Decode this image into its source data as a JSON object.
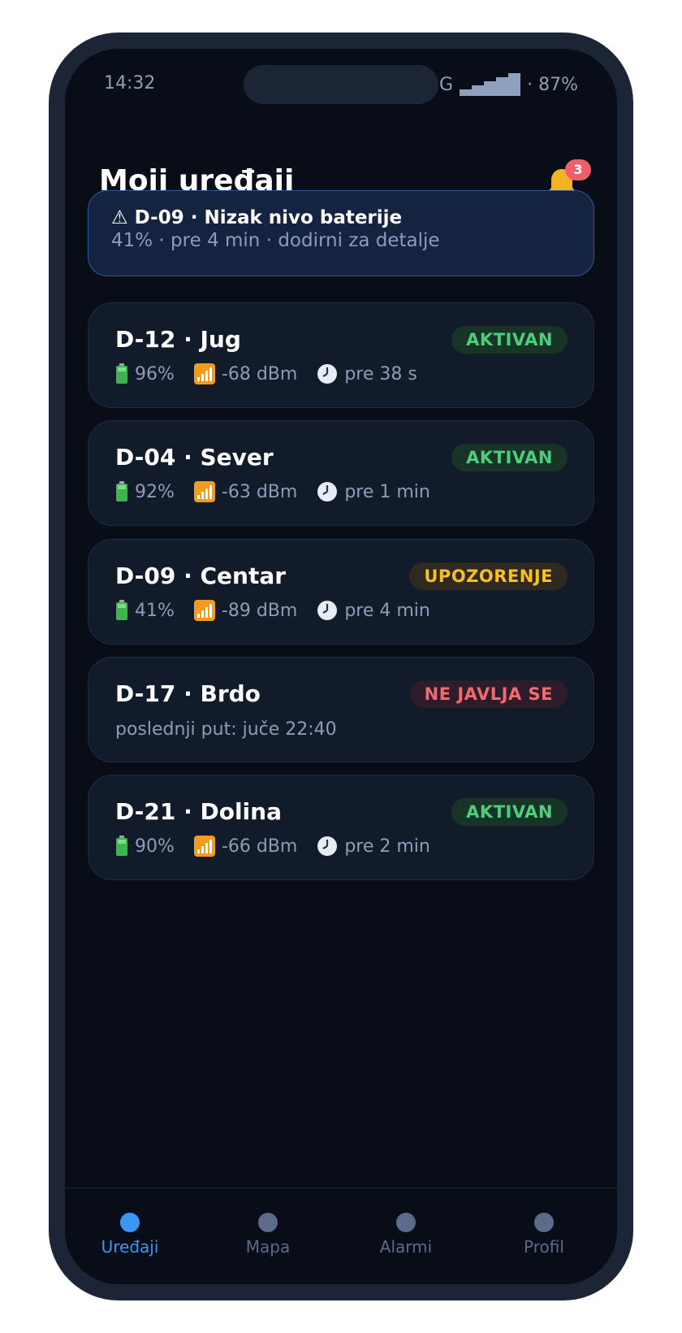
{
  "status_bar": {
    "time": "14:32",
    "network": "G",
    "battery": "· 87%"
  },
  "header": {
    "title": "Moji uređaji",
    "notification_count": "3"
  },
  "alert": {
    "title": "⚠ D-09 · Nizak nivo baterije",
    "subtitle": "41% · pre 4 min · dodirni za detalje"
  },
  "devices": [
    {
      "name": "D-12 · Jug",
      "status": "AKTIVAN",
      "status_kind": "ok",
      "battery": "96%",
      "signal": "-68 dBm",
      "last_seen": "pre 38 s"
    },
    {
      "name": "D-04 · Sever",
      "status": "AKTIVAN",
      "status_kind": "ok",
      "battery": "92%",
      "signal": "-63 dBm",
      "last_seen": "pre 1 min"
    },
    {
      "name": "D-09 · Centar",
      "status": "UPOZORENJE",
      "status_kind": "warn",
      "battery": "41%",
      "signal": "-89 dBm",
      "last_seen": "pre 4 min"
    },
    {
      "name": "D-17 · Brdo",
      "status": "NE JAVLJA SE",
      "status_kind": "off",
      "note": "poslednji put: juče 22:40"
    },
    {
      "name": "D-21 · Dolina",
      "status": "AKTIVAN",
      "status_kind": "ok",
      "battery": "90%",
      "signal": "-66 dBm",
      "last_seen": "pre 2 min"
    }
  ],
  "nav": {
    "items": [
      {
        "label": "Uređaji",
        "active": true
      },
      {
        "label": "Mapa",
        "active": false
      },
      {
        "label": "Alarmi",
        "active": false
      },
      {
        "label": "Profil",
        "active": false
      }
    ]
  },
  "colors": {
    "accent": "#3b97f3",
    "ok": "#4ccf7c",
    "warn": "#fbbf24",
    "error": "#ef6b6e",
    "background": "#080d18"
  }
}
